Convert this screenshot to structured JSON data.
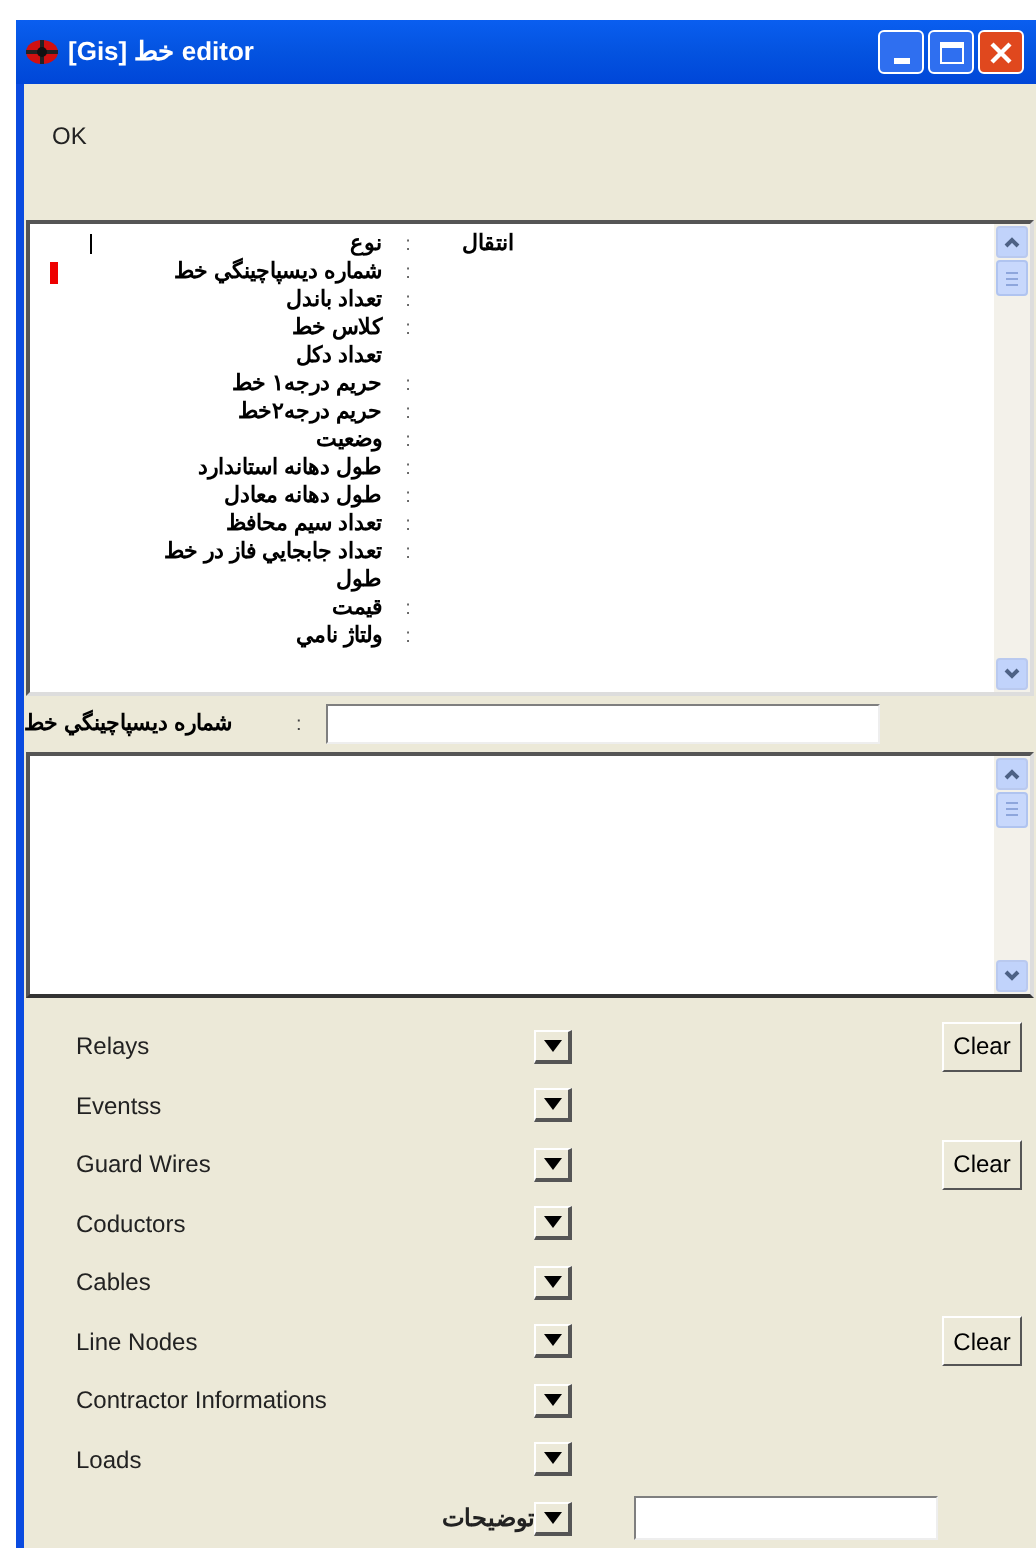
{
  "window": {
    "title": "[Gis] خط editor"
  },
  "menu": {
    "label": "OK"
  },
  "properties": [
    {
      "label": "نوع",
      "colon": ":",
      "value": "انتقال",
      "marked": false,
      "cursor": true
    },
    {
      "label": "شماره دیسپاچینگي خط",
      "colon": ":",
      "marked": true,
      "cursor": false
    },
    {
      "label": "تعداد باندل",
      "colon": ":",
      "marked": false,
      "cursor": false
    },
    {
      "label": "کلاس خط",
      "colon": ":",
      "marked": false,
      "cursor": false
    },
    {
      "label": "تعداد دکل",
      "marked": false,
      "cursor": false
    },
    {
      "label": "حریم درجه۱ خط",
      "colon": ":",
      "marked": false,
      "cursor": false
    },
    {
      "label": "حریم درجه۲خط",
      "colon": ":",
      "marked": false,
      "cursor": false
    },
    {
      "label": "وضعیت",
      "colon": ":",
      "marked": false,
      "cursor": false
    },
    {
      "label": "طول دهانه استاندارد",
      "colon": ":",
      "marked": false,
      "cursor": false
    },
    {
      "label": "طول دهانه معادل",
      "colon": ":",
      "marked": false,
      "cursor": false
    },
    {
      "label": "تعداد سیم محافظ",
      "colon": ":",
      "marked": false,
      "cursor": false
    },
    {
      "label": "تعداد جابجایي فاز در خط",
      "colon": ":",
      "marked": false,
      "cursor": false
    },
    {
      "label": "طول",
      "marked": false,
      "cursor": false
    },
    {
      "label": "قیمت",
      "colon": ":",
      "marked": false,
      "cursor": false
    },
    {
      "label": "ولتاژ نامي",
      "colon": ":",
      "marked": false,
      "cursor": false
    }
  ],
  "edit_row": {
    "label": "شماره دیسپاچینگي خط",
    "colon": ":"
  },
  "sections": [
    {
      "label": "Relays",
      "kind": "clear",
      "button": "Clear"
    },
    {
      "label": "Eventss",
      "kind": "plain"
    },
    {
      "label": "Guard Wires",
      "kind": "clear",
      "button": "Clear"
    },
    {
      "label": "Coductors",
      "kind": "plain"
    },
    {
      "label": "Cables",
      "kind": "plain"
    },
    {
      "label": "Line Nodes",
      "kind": "clear",
      "button": "Clear"
    },
    {
      "label": "Contractor Informations",
      "kind": "plain"
    },
    {
      "label": "Loads",
      "kind": "plain"
    },
    {
      "label": "توضیحات",
      "kind": "field"
    }
  ]
}
